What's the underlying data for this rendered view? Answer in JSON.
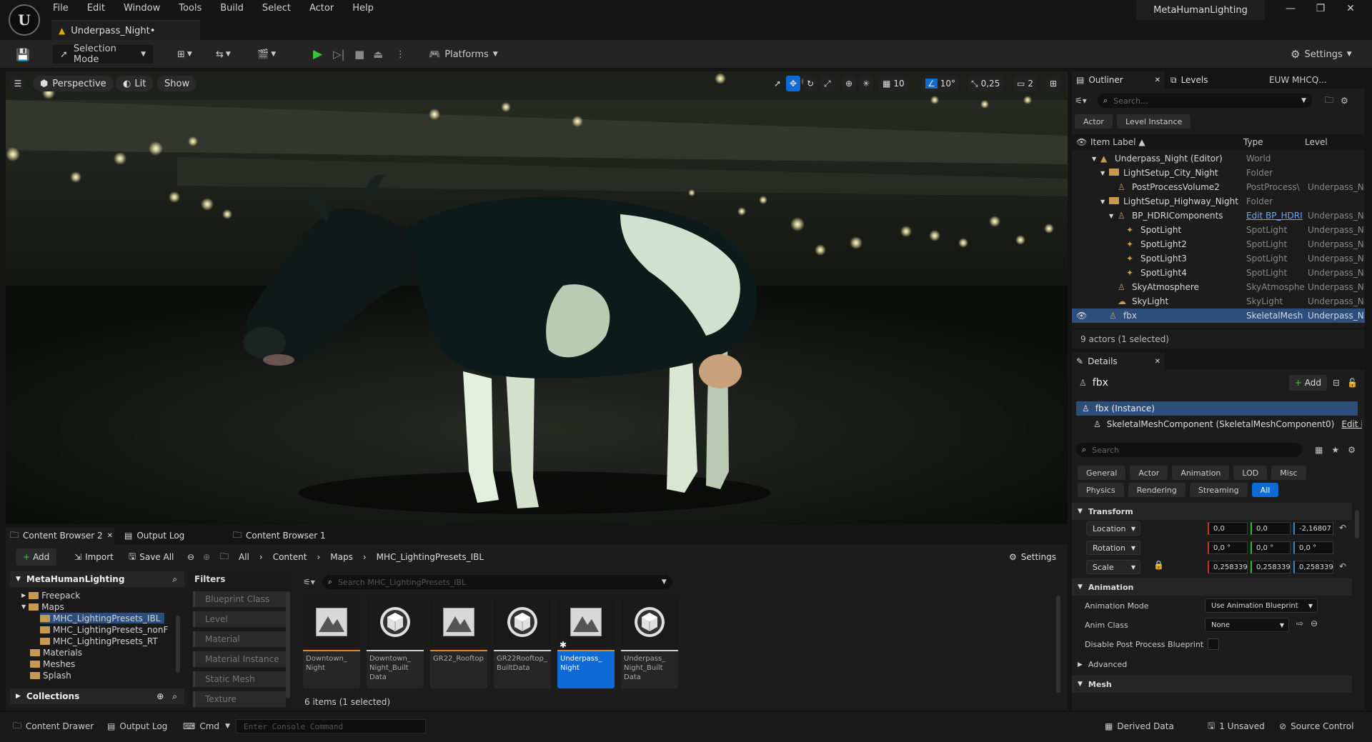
{
  "app": {
    "logo": "U",
    "project": "MetaHumanLighting",
    "document_tab": "Underpass_Night•"
  },
  "menu": [
    "File",
    "Edit",
    "Window",
    "Tools",
    "Build",
    "Select",
    "Actor",
    "Help"
  ],
  "toolbar": {
    "selection_mode": "Selection Mode",
    "platforms": "Platforms",
    "settings": "Settings"
  },
  "viewport": {
    "perspective": "Perspective",
    "lit": "Lit",
    "show": "Show",
    "grid_size": "10",
    "angle_snap": "10°",
    "scale_snap": "0,25",
    "camera_speed": "2"
  },
  "outliner": {
    "tab": "Outliner",
    "levels_tab": "Levels",
    "region": "EUW MHCQ...",
    "search_placeholder": "Search...",
    "chips": [
      "Actor",
      "Level Instance"
    ],
    "columns": {
      "label": "Item Label ▲",
      "type": "Type",
      "level": "Level"
    },
    "rows": [
      {
        "label": "Underpass_Night (Editor)",
        "type": "World",
        "level": "",
        "indent": 0
      },
      {
        "label": "LightSetup_City_Night",
        "type": "Folder",
        "level": "",
        "indent": 1
      },
      {
        "label": "PostProcessVolume2",
        "type": "PostProcess\\",
        "level": "Underpass_N",
        "indent": 2
      },
      {
        "label": "LightSetup_Highway_Night",
        "type": "Folder",
        "level": "",
        "indent": 1
      },
      {
        "label": "BP_HDRIComponents",
        "type": "Edit BP_HDRI",
        "level": "Underpass_N",
        "indent": 2
      },
      {
        "label": "SpotLight",
        "type": "SpotLight",
        "level": "Underpass_N",
        "indent": 3
      },
      {
        "label": "SpotLight2",
        "type": "SpotLight",
        "level": "Underpass_N",
        "indent": 3
      },
      {
        "label": "SpotLight3",
        "type": "SpotLight",
        "level": "Underpass_N",
        "indent": 3
      },
      {
        "label": "SpotLight4",
        "type": "SpotLight",
        "level": "Underpass_N",
        "indent": 3
      },
      {
        "label": "SkyAtmosphere",
        "type": "SkyAtmosphe",
        "level": "Underpass_N",
        "indent": 2
      },
      {
        "label": "SkyLight",
        "type": "SkyLight",
        "level": "Underpass_N",
        "indent": 2
      },
      {
        "label": "fbx",
        "type": "SkeletalMesh",
        "level": "Underpass_N",
        "indent": 1,
        "selected": true
      }
    ],
    "footer": "9 actors (1 selected)"
  },
  "details": {
    "tab": "Details",
    "object": "fbx",
    "add": "Add",
    "instance": "fbx (Instance)",
    "component": "SkeletalMeshComponent (SkeletalMeshComponent0)",
    "edit_in": "Edit in",
    "search_placeholder": "Search",
    "filters_row1": [
      "General",
      "Actor",
      "Animation",
      "LOD",
      "Misc"
    ],
    "filters_row2": [
      "Physics",
      "Rendering",
      "Streaming",
      "All"
    ],
    "transform": "Transform",
    "location": {
      "label": "Location",
      "x": "0,0",
      "y": "0,0",
      "z": "-2,16807"
    },
    "rotation": {
      "label": "Rotation",
      "x": "0,0 °",
      "y": "0,0 °",
      "z": "0,0 °"
    },
    "scale": {
      "label": "Scale",
      "x": "0,258339",
      "y": "0,258339",
      "z": "0,258339"
    },
    "animation": "Animation",
    "anim_mode_label": "Animation Mode",
    "anim_mode_value": "Use Animation Blueprint",
    "anim_class_label": "Anim Class",
    "anim_class_value": "None",
    "disable_pp_label": "Disable Post Process Blueprint",
    "advanced": "Advanced",
    "mesh": "Mesh"
  },
  "content_browser": {
    "tab": "Content Browser 2",
    "output_tab": "Output Log",
    "cb1_tab": "Content Browser 1",
    "add": "Add",
    "import": "Import",
    "save_all": "Save All",
    "path": [
      "All",
      "Content",
      "Maps",
      "MHC_LightingPresets_IBL"
    ],
    "settings": "Settings",
    "tree_root": "MetaHumanLighting",
    "tree": [
      {
        "label": "Freepack",
        "indent": 1
      },
      {
        "label": "Maps",
        "indent": 1
      },
      {
        "label": "MHC_LightingPresets_IBL",
        "indent": 2,
        "selected": true
      },
      {
        "label": "MHC_LightingPresets_nonF",
        "indent": 2
      },
      {
        "label": "MHC_LightingPresets_RT",
        "indent": 2
      },
      {
        "label": "Materials",
        "indent": 1
      },
      {
        "label": "Meshes",
        "indent": 1
      },
      {
        "label": "Splash",
        "indent": 1
      }
    ],
    "collections": "Collections",
    "filters_title": "Filters",
    "filters": [
      "Blueprint Class",
      "Level",
      "Material",
      "Material Instance",
      "Static Mesh",
      "Texture"
    ],
    "search_placeholder": "Search MHC_LightingPresets_IBL",
    "assets": [
      {
        "name": "Downtown_ Night",
        "kind": "map",
        "bar": "#d98a2a"
      },
      {
        "name": "Downtown_ Night_Built Data",
        "kind": "data",
        "bar": "#cfcfcf"
      },
      {
        "name": "GR22_Rooftop",
        "kind": "map",
        "bar": "#d98a2a"
      },
      {
        "name": "GR22Rooftop_ BuiltData",
        "kind": "data",
        "bar": "#cfcfcf"
      },
      {
        "name": "Underpass_ Night",
        "kind": "map",
        "bar": "#d98a2a",
        "selected": true
      },
      {
        "name": "Underpass_ Night_Built Data",
        "kind": "data",
        "bar": "#cfcfcf"
      }
    ],
    "count": "6 items (1 selected)"
  },
  "status": {
    "content_drawer": "Content Drawer",
    "output_log": "Output Log",
    "cmd": "Cmd",
    "console_placeholder": "Enter Console Command",
    "derived_data": "Derived Data",
    "unsaved": "1 Unsaved",
    "source_control": "Source Control"
  },
  "colors": {
    "accent": "#0e6bd6",
    "selection": "#2d4e7a",
    "panel": "#1c1c1c",
    "play": "#3ac43a",
    "warn": "#e5a100"
  }
}
